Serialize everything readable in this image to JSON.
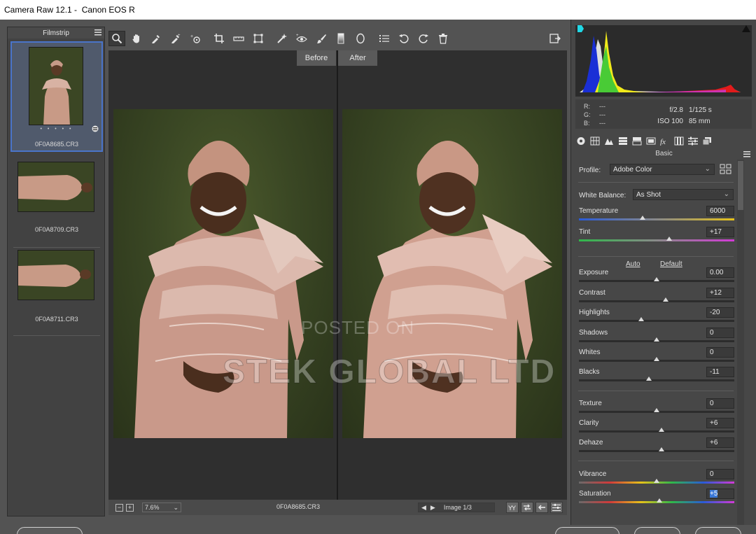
{
  "window": {
    "title": "Camera Raw 12.1 -  Canon EOS R"
  },
  "filmstrip": {
    "header": "Filmstrip",
    "items": [
      {
        "filename": "0F0A8685.CR3",
        "rating": "• • • • •",
        "selected": true
      },
      {
        "filename": "0F0A8709.CR3"
      },
      {
        "filename": "0F0A8711.CR3"
      }
    ]
  },
  "toolbar": {
    "tools": [
      "zoom-icon",
      "hand-icon",
      "white-balance-icon",
      "color-sampler-icon",
      "targeted-adjustment-icon",
      "crop-icon",
      "straighten-icon",
      "transform-icon",
      "spot-removal-icon",
      "red-eye-icon",
      "adjustment-brush-icon",
      "graduated-filter-icon",
      "radial-filter-icon",
      "preferences-icon",
      "rotate-left-icon",
      "rotate-right-icon",
      "trash-icon"
    ],
    "fullscreen_icon": "fullscreen-icon"
  },
  "preview": {
    "before_label": "Before",
    "after_label": "After",
    "watermark_line1": "POSTED ON",
    "watermark_line2": "STEK GLOBAL LTD"
  },
  "status": {
    "zoom_out": "−",
    "zoom_in": "+",
    "zoom": "7.6%",
    "filename": "0F0A8685.CR3",
    "image_counter": "Image 1/3"
  },
  "camera_info": {
    "r_label": "R:",
    "r_value": "---",
    "g_label": "G:",
    "g_value": "---",
    "b_label": "B:",
    "b_value": "---",
    "aperture": "f/2.8",
    "shutter": "1/125 s",
    "iso": "ISO 100",
    "focal": "85 mm"
  },
  "panel": {
    "title": "Basic",
    "profile_label": "Profile:",
    "profile_value": "Adobe Color",
    "wb_label": "White Balance:",
    "wb_value": "As Shot",
    "auto_label": "Auto",
    "default_label": "Default",
    "sliders": [
      {
        "label": "Temperature",
        "value": "6000",
        "pos": 0.41
      },
      {
        "label": "Tint",
        "value": "+17",
        "pos": 0.58
      },
      {
        "label": "Exposure",
        "value": "0.00",
        "pos": 0.5
      },
      {
        "label": "Contrast",
        "value": "+12",
        "pos": 0.56
      },
      {
        "label": "Highlights",
        "value": "-20",
        "pos": 0.4
      },
      {
        "label": "Shadows",
        "value": "0",
        "pos": 0.5
      },
      {
        "label": "Whites",
        "value": "0",
        "pos": 0.5
      },
      {
        "label": "Blacks",
        "value": "-11",
        "pos": 0.45
      },
      {
        "label": "Texture",
        "value": "0",
        "pos": 0.5
      },
      {
        "label": "Clarity",
        "value": "+6",
        "pos": 0.53
      },
      {
        "label": "Dehaze",
        "value": "+6",
        "pos": 0.53
      },
      {
        "label": "Vibrance",
        "value": "0",
        "pos": 0.5
      },
      {
        "label": "Saturation",
        "value": "+5",
        "pos": 0.52
      }
    ]
  },
  "colors": {
    "accent": "#4a74c9",
    "panel": "#474747",
    "background": "#535353"
  }
}
